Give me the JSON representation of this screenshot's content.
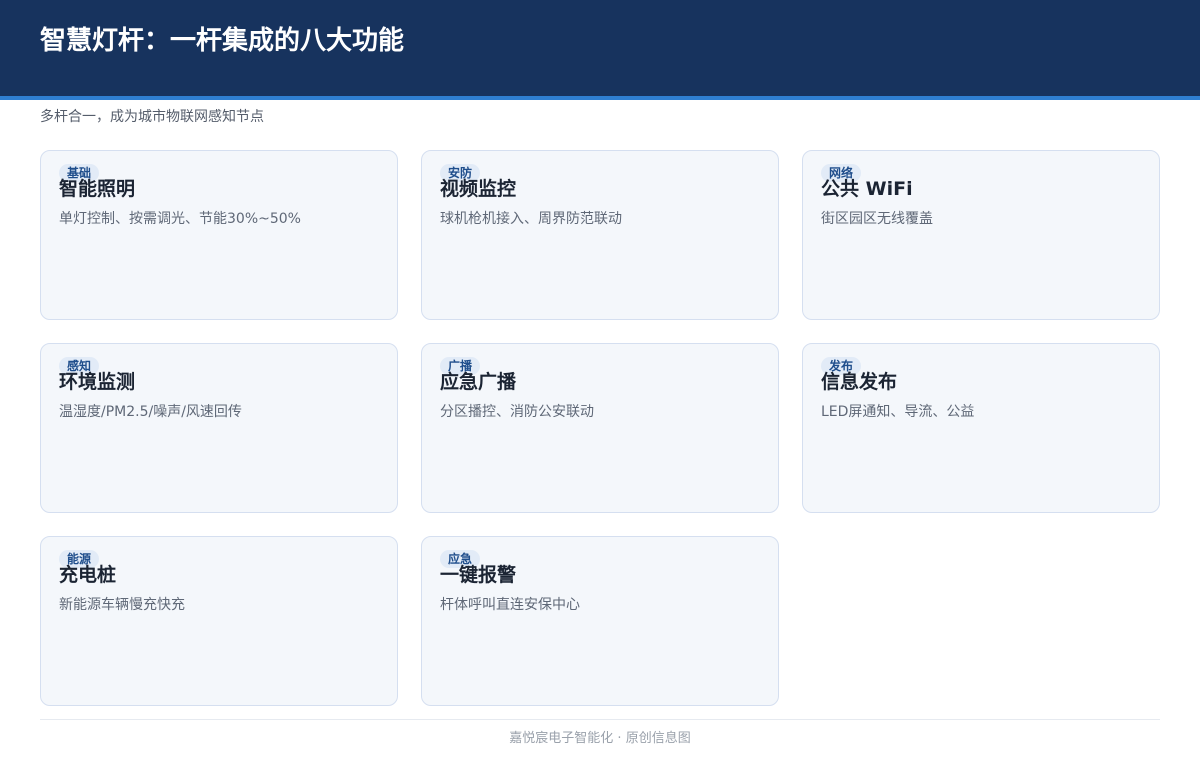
{
  "header": {
    "title": "智慧灯杆：一杆集成的八大功能",
    "subtitle": "多杆合一，成为城市物联网感知节点"
  },
  "cards": [
    {
      "tag": "基础",
      "title": "智能照明",
      "desc": "单灯控制、按需调光、节能30%~50%"
    },
    {
      "tag": "安防",
      "title": "视频监控",
      "desc": "球机枪机接入、周界防范联动"
    },
    {
      "tag": "网络",
      "title": "公共 WiFi",
      "desc": "街区园区无线覆盖"
    },
    {
      "tag": "感知",
      "title": "环境监测",
      "desc": "温湿度/PM2.5/噪声/风速回传"
    },
    {
      "tag": "广播",
      "title": "应急广播",
      "desc": "分区播控、消防公安联动"
    },
    {
      "tag": "发布",
      "title": "信息发布",
      "desc": "LED屏通知、导流、公益"
    },
    {
      "tag": "能源",
      "title": "充电桩",
      "desc": "新能源车辆慢充快充"
    },
    {
      "tag": "应急",
      "title": "一键报警",
      "desc": "杆体呼叫直连安保中心"
    }
  ],
  "footer": {
    "text": "嘉悦宸电子智能化 · 原创信息图"
  },
  "colors": {
    "header_bg": "#17335e",
    "header_accent": "#2f7fd1",
    "card_bg": "#f4f7fb",
    "tag_text": "#1f4e8c"
  }
}
